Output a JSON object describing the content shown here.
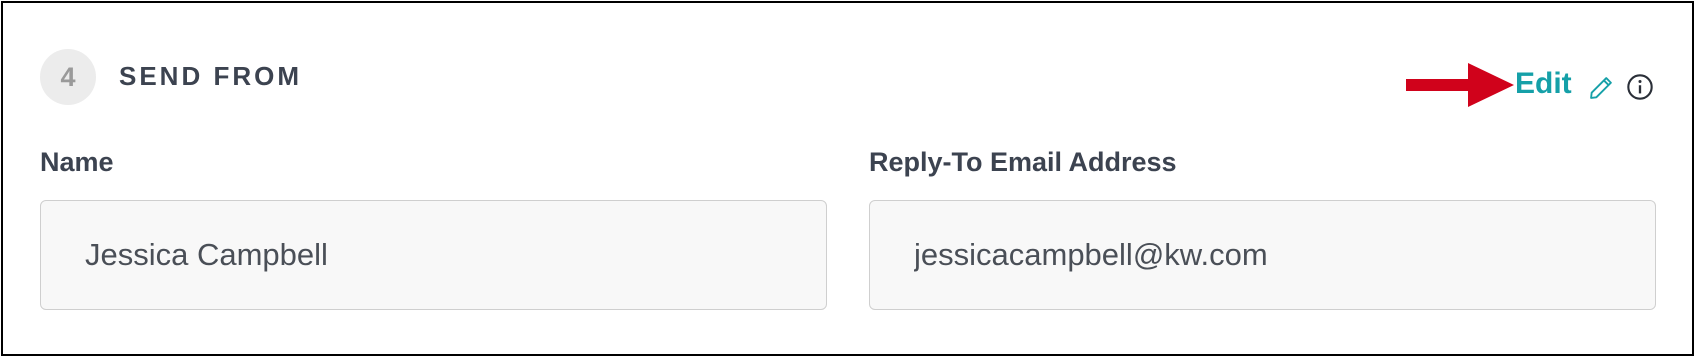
{
  "section": {
    "step_number": "4",
    "title": "SEND FROM"
  },
  "actions": {
    "edit_label": "Edit",
    "edit_icon": "pencil-icon",
    "info_icon": "info-icon",
    "annotation_arrow_color": "#d0021b",
    "accent_color": "#15a0a8"
  },
  "fields": {
    "name": {
      "label": "Name",
      "value": "Jessica Campbell"
    },
    "reply_to": {
      "label": "Reply-To Email Address",
      "value": "jessicacampbell@kw.com"
    }
  }
}
